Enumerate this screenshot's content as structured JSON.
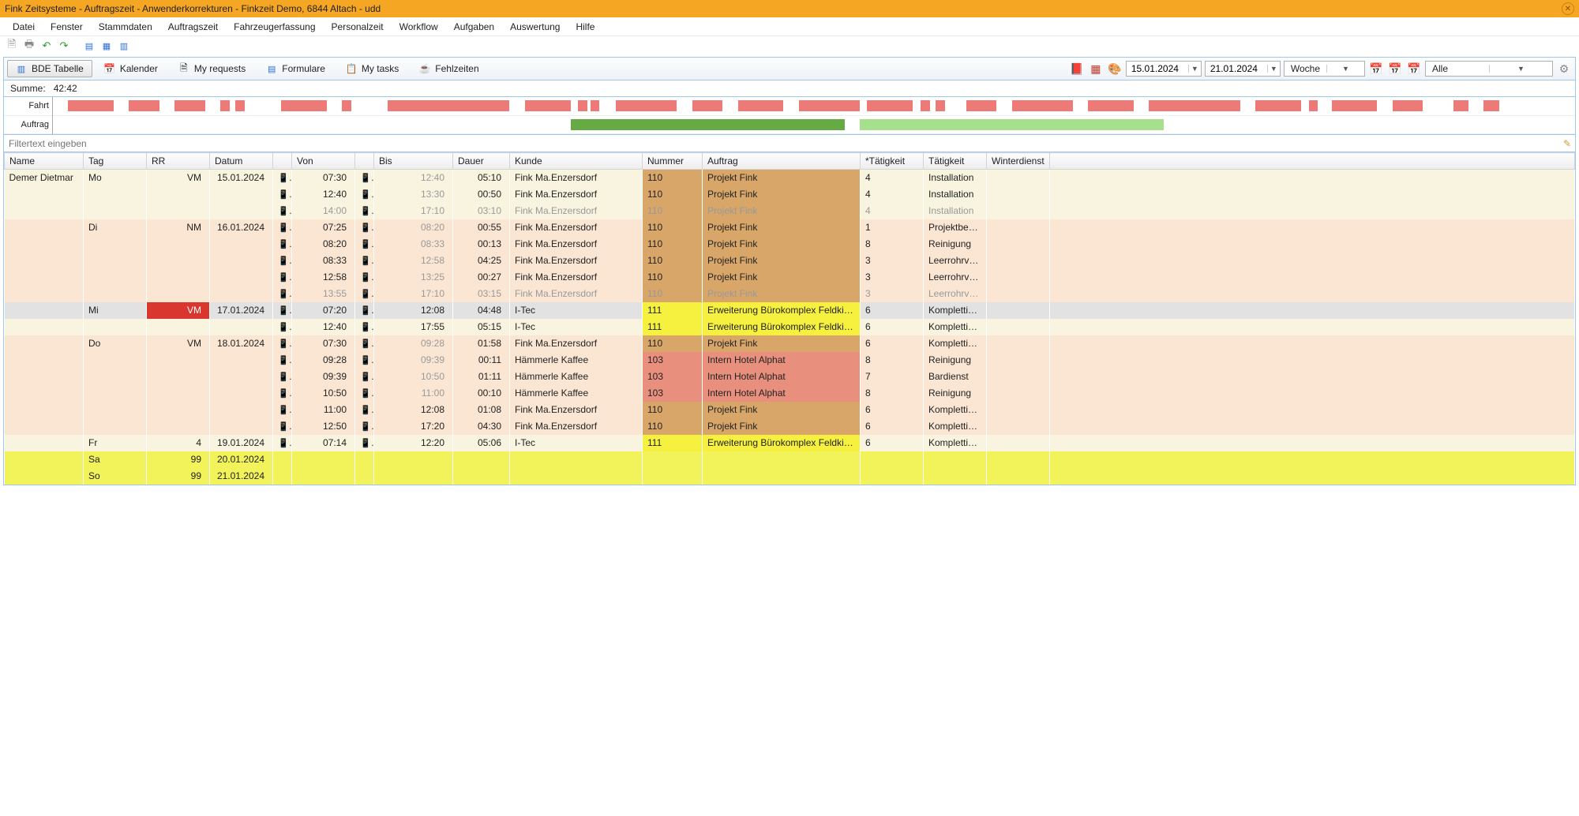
{
  "title": "Fink Zeitsysteme - Auftragszeit - Anwenderkorrekturen - Finkzeit Demo, 6844 Altach - udd",
  "menu": [
    "Datei",
    "Fenster",
    "Stammdaten",
    "Auftragszeit",
    "Fahrzeugerfassung",
    "Personalzeit",
    "Workflow",
    "Aufgaben",
    "Auswertung",
    "Hilfe"
  ],
  "tabs": {
    "bde": "BDE Tabelle",
    "kalender": "Kalender",
    "requests": "My requests",
    "formulare": "Formulare",
    "tasks": "My tasks",
    "fehl": "Fehlzeiten"
  },
  "date_from": "15.01.2024",
  "date_to": "21.01.2024",
  "range": "Woche",
  "filter_all": "Alle",
  "summary_label": "Summe:",
  "summary_value": "42:42",
  "timeline_labels": {
    "fahrt": "Fahrt",
    "auftrag": "Auftrag"
  },
  "filter_placeholder": "Filtertext eingeben",
  "columns": [
    "Name",
    "Tag",
    "RR",
    "Datum",
    "Von",
    "Bis",
    "Dauer",
    "Kunde",
    "Nummer",
    "Auftrag",
    "*Tätigkeit",
    "Tätigkeit",
    "Winterdienst"
  ],
  "rows": [
    {
      "cls": "row-cream",
      "name": "Demer Dietmar",
      "tag": "Mo",
      "rr": "VM",
      "datum": "15.01.2024",
      "von": "07:30",
      "bis": "12:40",
      "bis_dim": true,
      "dauer": "05:10",
      "kunde": "Fink Ma.Enzersdorf",
      "num": "110",
      "numc": "num-orange",
      "auf": "Projekt Fink",
      "aufc": "auf-orange",
      "tkey": "4",
      "taet": "Installation"
    },
    {
      "cls": "row-cream",
      "von": "12:40",
      "bis": "13:30",
      "bis_dim": true,
      "dauer": "00:50",
      "kunde": "Fink Ma.Enzersdorf",
      "num": "110",
      "numc": "num-orange",
      "auf": "Projekt Fink",
      "aufc": "auf-orange",
      "tkey": "4",
      "taet": "Installation"
    },
    {
      "cls": "row-cream",
      "dim": true,
      "von": "14:00",
      "bis": "17:10",
      "dauer": "03:10",
      "kunde": "Fink Ma.Enzersdorf",
      "num": "110",
      "numc": "num-orange",
      "auf": "Projekt Fink",
      "aufc": "auf-orange",
      "tkey": "4",
      "taet": "Installation"
    },
    {
      "cls": "row-peach",
      "tag": "Di",
      "rr": "NM",
      "datum": "16.01.2024",
      "von": "07:25",
      "bis": "08:20",
      "bis_dim": true,
      "dauer": "00:55",
      "kunde": "Fink Ma.Enzersdorf",
      "num": "110",
      "numc": "num-orange",
      "auf": "Projekt Fink",
      "aufc": "auf-orange",
      "tkey": "1",
      "taet": "Projektbesp..."
    },
    {
      "cls": "row-peach",
      "von": "08:20",
      "bis": "08:33",
      "bis_dim": true,
      "dauer": "00:13",
      "kunde": "Fink Ma.Enzersdorf",
      "num": "110",
      "numc": "num-orange",
      "auf": "Projekt Fink",
      "aufc": "auf-orange",
      "tkey": "8",
      "taet": "Reinigung"
    },
    {
      "cls": "row-peach",
      "von": "08:33",
      "bis": "12:58",
      "bis_dim": true,
      "dauer": "04:25",
      "kunde": "Fink Ma.Enzersdorf",
      "num": "110",
      "numc": "num-orange",
      "auf": "Projekt Fink",
      "aufc": "auf-orange",
      "tkey": "3",
      "taet": "Leerrohrver..."
    },
    {
      "cls": "row-peach",
      "von": "12:58",
      "bis": "13:25",
      "bis_dim": true,
      "dauer": "00:27",
      "kunde": "Fink Ma.Enzersdorf",
      "num": "110",
      "numc": "num-orange",
      "auf": "Projekt Fink",
      "aufc": "auf-orange",
      "tkey": "3",
      "taet": "Leerrohrver..."
    },
    {
      "cls": "row-peach",
      "dim": true,
      "von": "13:55",
      "bis": "17:10",
      "dauer": "03:15",
      "kunde": "Fink Ma.Enzersdorf",
      "num": "110",
      "numc": "num-orange",
      "auf": "Projekt Fink",
      "aufc": "auf-orange",
      "tkey": "3",
      "taet": "Leerrohrver..."
    },
    {
      "cls": "row-gray",
      "tag": "Mi",
      "rr": "VM",
      "rr_red": true,
      "datum": "17.01.2024",
      "von": "07:20",
      "bis": "12:08",
      "dauer": "04:48",
      "kunde": "I-Tec",
      "num": "111",
      "numc": "num-yellow",
      "auf": "Erweiterung Bürokomplex Feldkirch",
      "aufc": "auf-yellow",
      "tkey": "6",
      "taet": "Komplettier..."
    },
    {
      "cls": "row-cream",
      "von": "12:40",
      "bis": "17:55",
      "dauer": "05:15",
      "kunde": "I-Tec",
      "num": "111",
      "numc": "num-yellow",
      "auf": "Erweiterung Bürokomplex Feldkirch",
      "aufc": "auf-yellow",
      "tkey": "6",
      "taet": "Komplettier..."
    },
    {
      "cls": "row-peach",
      "tag": "Do",
      "rr": "VM",
      "datum": "18.01.2024",
      "von": "07:30",
      "bis": "09:28",
      "bis_dim": true,
      "dauer": "01:58",
      "kunde": "Fink Ma.Enzersdorf",
      "num": "110",
      "numc": "num-orange",
      "auf": "Projekt Fink",
      "aufc": "auf-orange",
      "tkey": "6",
      "taet": "Komplettier..."
    },
    {
      "cls": "row-peach",
      "von": "09:28",
      "bis": "09:39",
      "bis_dim": true,
      "dauer": "00:11",
      "kunde": "Hämmerle Kaffee",
      "num": "103",
      "numc": "num-salmon",
      "auf": "Intern Hotel Alphat",
      "aufc": "auf-salmon",
      "tkey": "8",
      "taet": "Reinigung"
    },
    {
      "cls": "row-peach",
      "von": "09:39",
      "bis": "10:50",
      "bis_dim": true,
      "dauer": "01:11",
      "kunde": "Hämmerle Kaffee",
      "num": "103",
      "numc": "num-salmon",
      "auf": "Intern Hotel Alphat",
      "aufc": "auf-salmon",
      "tkey": "7",
      "taet": "Bardienst"
    },
    {
      "cls": "row-peach",
      "von": "10:50",
      "bis": "11:00",
      "bis_dim": true,
      "dauer": "00:10",
      "kunde": "Hämmerle Kaffee",
      "num": "103",
      "numc": "num-salmon",
      "auf": "Intern Hotel Alphat",
      "aufc": "auf-salmon",
      "tkey": "8",
      "taet": "Reinigung"
    },
    {
      "cls": "row-peach",
      "von": "11:00",
      "bis": "12:08",
      "dauer": "01:08",
      "kunde": "Fink Ma.Enzersdorf",
      "num": "110",
      "numc": "num-orange",
      "auf": "Projekt Fink",
      "aufc": "auf-orange",
      "tkey": "6",
      "taet": "Komplettier..."
    },
    {
      "cls": "row-peach",
      "von": "12:50",
      "bis": "17:20",
      "dauer": "04:30",
      "kunde": "Fink Ma.Enzersdorf",
      "num": "110",
      "numc": "num-orange",
      "auf": "Projekt Fink",
      "aufc": "auf-orange",
      "tkey": "6",
      "taet": "Komplettier..."
    },
    {
      "cls": "row-cream",
      "tag": "Fr",
      "rr": "4",
      "datum": "19.01.2024",
      "von": "07:14",
      "bis": "12:20",
      "dauer": "05:06",
      "kunde": "I-Tec",
      "num": "111",
      "numc": "num-yellow",
      "auf": "Erweiterung Bürokomplex Feldkirch",
      "aufc": "auf-yellow",
      "tkey": "6",
      "taet": "Komplettier..."
    },
    {
      "cls": "row-yellow",
      "tag": "Sa",
      "rr": "99",
      "datum": "20.01.2024"
    },
    {
      "cls": "row-yellow",
      "tag": "So",
      "rr": "99",
      "datum": "21.01.2024"
    }
  ]
}
